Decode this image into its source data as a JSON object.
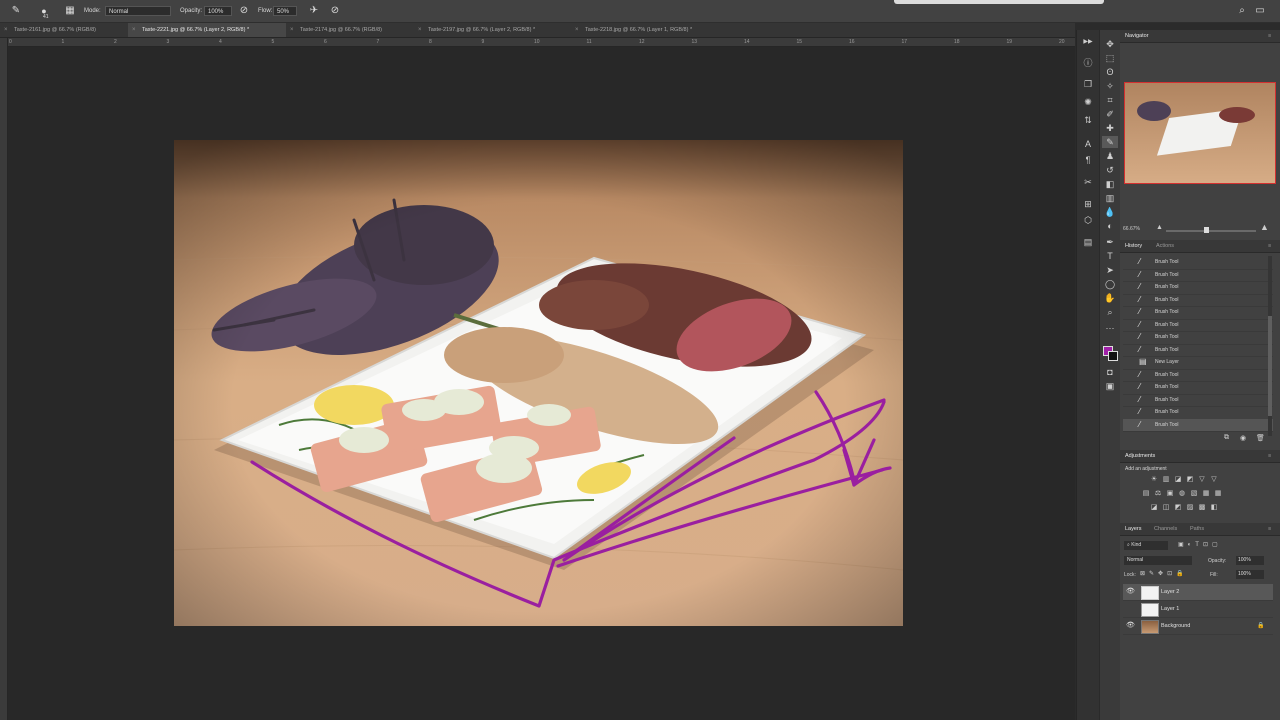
{
  "options_bar": {
    "brush_size": "41",
    "mode_label": "Mode:",
    "mode_value": "Normal",
    "opacity_label": "Opacity:",
    "opacity_value": "100%",
    "flow_label": "Flow:",
    "flow_value": "50%"
  },
  "tabs": [
    {
      "label": "Taste-2161.jpg @ 66.7% (RGB/8)"
    },
    {
      "label": "Taste-2221.jpg @ 66.7% (Layer 2, RGB/8) *"
    },
    {
      "label": "Taste-2174.jpg @ 66.7% (RGB/8)"
    },
    {
      "label": "Taste-2197.jpg @ 66.7% (Layer 2, RGB/8) *"
    },
    {
      "label": "Taste-2218.jpg @ 66.7% (Layer 1, RGB/8) *"
    }
  ],
  "ruler_numbers": [
    "0",
    "1",
    "2",
    "3",
    "4",
    "5",
    "6",
    "7",
    "8",
    "9",
    "10",
    "11",
    "12",
    "13",
    "14",
    "15",
    "16",
    "17",
    "18",
    "19",
    "20"
  ],
  "navigator": {
    "title": "Navigator",
    "zoom": "66.67%"
  },
  "history": {
    "tab_history": "History",
    "tab_actions": "Actions",
    "items": [
      "Brush Tool",
      "Brush Tool",
      "Brush Tool",
      "Brush Tool",
      "Brush Tool",
      "Brush Tool",
      "Brush Tool",
      "Brush Tool",
      "New Layer",
      "Brush Tool",
      "Brush Tool",
      "Brush Tool",
      "Brush Tool",
      "Brush Tool"
    ]
  },
  "adjustments": {
    "title": "Adjustments",
    "subtitle": "Add an adjustment"
  },
  "layers": {
    "tab_layers": "Layers",
    "tab_channels": "Channels",
    "tab_paths": "Paths",
    "filter_kind": "Kind",
    "blend_mode": "Normal",
    "opacity_label": "Opacity:",
    "opacity_value": "100%",
    "lock_label": "Lock:",
    "fill_label": "Fill:",
    "fill_value": "100%",
    "rows": [
      "Layer 2",
      "Layer 1",
      "Background"
    ]
  },
  "colors": {
    "accent_stroke": "#9a1fa0",
    "foreground_swatch": "#a020a8"
  }
}
